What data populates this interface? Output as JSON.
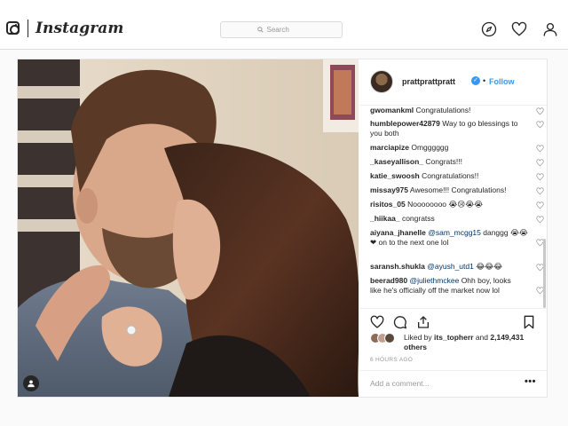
{
  "header": {
    "wordmark": "Instagram",
    "search_placeholder": "Search",
    "icons": [
      "instagram-glyph-icon",
      "search-icon",
      "explore-compass-icon",
      "activity-heart-icon",
      "profile-icon"
    ]
  },
  "post": {
    "author": "prattprattpratt",
    "verified": true,
    "follow_label": "Follow",
    "separator": "•",
    "comments": [
      {
        "user": "gwomankml",
        "text": "Congratulations!"
      },
      {
        "user": "humblepower42879",
        "text": "Way to go blessings to you both"
      },
      {
        "user": "marciapize",
        "text": "Omgggggg"
      },
      {
        "user": "_kaseyallison_",
        "text": "Congrats!!!"
      },
      {
        "user": "katie_swoosh",
        "text": "Congratulations!!"
      },
      {
        "user": "missay975",
        "text": "Awesome!!! Congratulations!"
      },
      {
        "user": "risitos_05",
        "text": "Noooooooo",
        "emoji": "😭😢😭😭"
      },
      {
        "user": "_hiikaa_",
        "text": "congratss"
      },
      {
        "user": "aiyana_jhanelle",
        "mention": "@sam_mcgg15",
        "text": "danggg",
        "emoji": "😭😭❤",
        "text2": "on to the next one lol"
      },
      {
        "user": "saransh.shukla",
        "mention": "@ayush_utd1",
        "emoji": "😂😂😂"
      },
      {
        "user": "beerad980",
        "mention": "@juliethmckee",
        "text": "Ohh boy, looks like he's officially off the market now lol"
      }
    ],
    "likes_prefix": "Liked by",
    "liked_by_user": "its_topherr",
    "likes_and": "and",
    "likes_count": "2,149,431 others",
    "timestamp": "6 HOURS AGO",
    "add_comment_placeholder": "Add a comment...",
    "more_label": "•••"
  },
  "colors": {
    "link_blue": "#3897f0",
    "mention_blue": "#003569",
    "border": "#dbdbdb",
    "background": "#fafafa"
  }
}
